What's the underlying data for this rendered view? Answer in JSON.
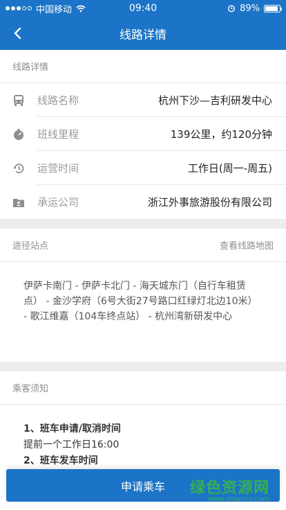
{
  "status": {
    "carrier": "中国移动",
    "time": "09:40",
    "battery": "89%",
    "battery_level": 0.89
  },
  "nav": {
    "title": "线路详情"
  },
  "details": {
    "header": "线路详情",
    "rows": [
      {
        "icon": "bus-icon",
        "label": "线路名称",
        "value": "杭州下沙—吉利研发中心"
      },
      {
        "icon": "distance-icon",
        "label": "班线里程",
        "value": "139公里，约120分钟"
      },
      {
        "icon": "history-icon",
        "label": "运营时间",
        "value": "工作日(周一-周五)"
      },
      {
        "icon": "company-folder-icon",
        "label": "承运公司",
        "value": "浙江外事旅游股份有限公司"
      }
    ]
  },
  "stops": {
    "header": "途径站点",
    "map_link": "查看线路地图",
    "text": "伊萨卡南门 - 伊萨卡北门 - 海天城东门（自行车租赁点） - 金沙学府（6号大街27号路口红绿灯北边10米） - 歌江维嘉（104车终点站） - 杭州湾新研发中心"
  },
  "notice": {
    "header": "乘客须知",
    "item1_title": "1、班车申请/取消时间",
    "item1_text": "提前一个工作日16:00",
    "item2_title": "2、班车发车时间"
  },
  "action": {
    "apply_label": "申请乘车"
  },
  "watermark": {
    "big": "绿色资源网",
    "small": "www.downcc.com"
  },
  "colors": {
    "primary": "#1b74c7",
    "background": "#ededed",
    "watermark": "#39b54a"
  }
}
